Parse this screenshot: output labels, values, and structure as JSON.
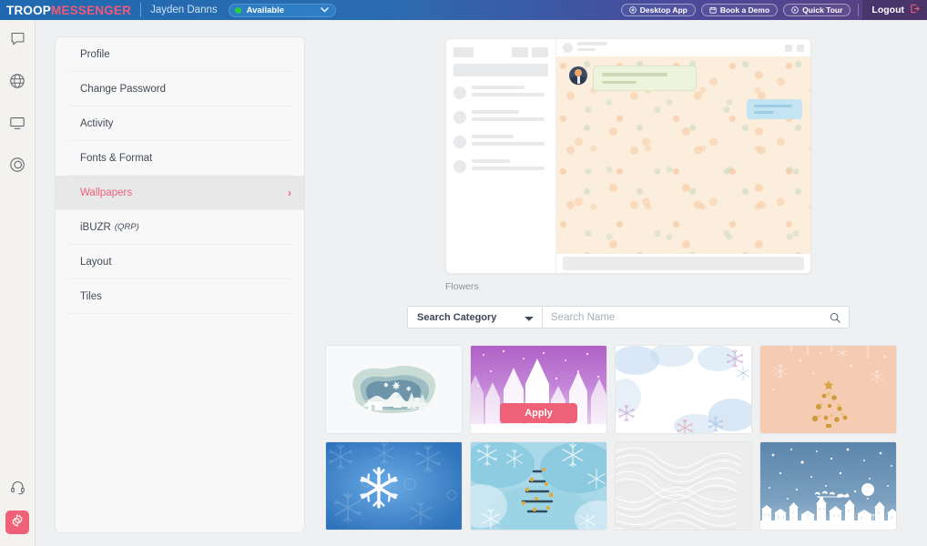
{
  "topbar": {
    "logo_first": "TROOP",
    "logo_second": "MESSENGER",
    "username": "Jayden Danns",
    "status": "Available",
    "status_color": "#2ecc40",
    "buttons": [
      {
        "label": "Desktop App",
        "icon": "download-icon"
      },
      {
        "label": "Book a Demo",
        "icon": "calendar-icon"
      },
      {
        "label": "Quick Tour",
        "icon": "play-icon"
      }
    ],
    "logout_label": "Logout"
  },
  "rail": {
    "items": [
      {
        "name": "chat-icon"
      },
      {
        "name": "globe-icon"
      },
      {
        "name": "monitor-icon"
      },
      {
        "name": "orbit-icon"
      }
    ],
    "bottom": [
      {
        "name": "headset-icon"
      },
      {
        "name": "gear-icon",
        "active": true
      }
    ],
    "active_color": "#ef6177"
  },
  "settings_menu": {
    "items": [
      {
        "label": "Profile",
        "active": false
      },
      {
        "label": "Change Password",
        "active": false
      },
      {
        "label": "Activity",
        "active": false
      },
      {
        "label": "Fonts & Format",
        "active": false
      },
      {
        "label": "Wallpapers",
        "active": true,
        "chevron": "›"
      },
      {
        "label": "iBUZR",
        "sub": "(QRP)",
        "active": false
      },
      {
        "label": "Layout",
        "active": false
      },
      {
        "label": "Tiles",
        "active": false
      }
    ]
  },
  "preview": {
    "label": "Flowers",
    "wallpaper_color": "#fceedd"
  },
  "search": {
    "category_selected": "Search Category",
    "category_options": [
      "Search Category"
    ],
    "name_placeholder": "Search Name",
    "search_icon": "search-icon"
  },
  "wallpapers": {
    "apply_label": "Apply",
    "apply_color": "#ef6177",
    "tiles": [
      {
        "name": "papercut-winter-scene",
        "hovered": false
      },
      {
        "name": "purple-forest",
        "hovered": true
      },
      {
        "name": "watercolor-snowflakes",
        "hovered": false
      },
      {
        "name": "peach-golden-tree",
        "hovered": false
      },
      {
        "name": "blue-snowflake",
        "hovered": false
      },
      {
        "name": "teal-watercolor-tree",
        "hovered": false
      },
      {
        "name": "white-texture",
        "hovered": false
      },
      {
        "name": "blue-night-village",
        "hovered": false
      }
    ]
  }
}
